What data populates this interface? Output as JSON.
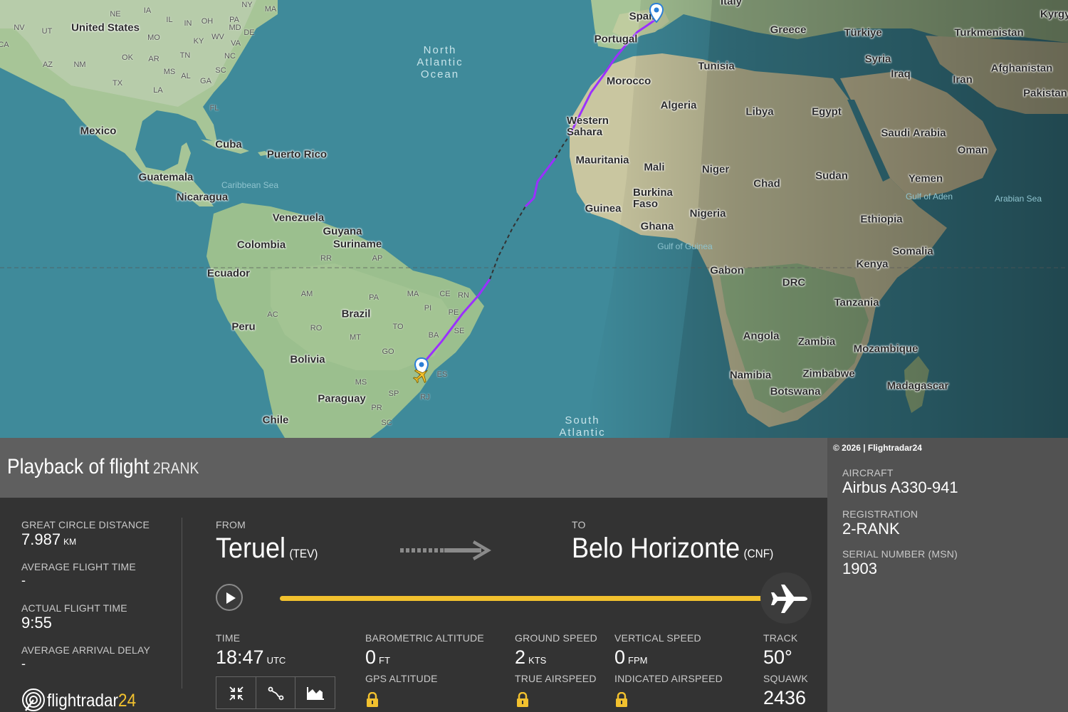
{
  "map": {
    "oceans": [
      {
        "lines": [
          "North",
          "Atlantic",
          "Ocean"
        ]
      },
      {
        "lines": [
          "South",
          "Atlantic"
        ]
      }
    ],
    "seas": [
      "Caribbean Sea",
      "Gulf of Guinea",
      "Gulf of Aden",
      "Arabian Sea"
    ],
    "countries": [
      "United States",
      "Mexico",
      "Cuba",
      "Puerto Rico",
      "Guatemala",
      "Nicaragua",
      "Venezuela",
      "Guyana",
      "Suriname",
      "Colombia",
      "Ecuador",
      "Brazil",
      "Peru",
      "Bolivia",
      "Paraguay",
      "Chile",
      "Portugal",
      "Spain",
      "Italy",
      "Greece",
      "Türkiye",
      "Turkmenistan",
      "Syria",
      "Iraq",
      "Iran",
      "Afghanistan",
      "Pakistan",
      "Tunisia",
      "Morocco",
      "Algeria",
      "Libya",
      "Egypt",
      "Saudi Arabia",
      "Oman",
      "Yemen",
      "Western Sahara",
      "Mauritania",
      "Mali",
      "Niger",
      "Chad",
      "Sudan",
      "Burkina Faso",
      "Guinea",
      "Ghana",
      "Nigeria",
      "Ethiopia",
      "Somalia",
      "Kenya",
      "Gabon",
      "DRC",
      "Tanzania",
      "Angola",
      "Zambia",
      "Mozambique",
      "Namibia",
      "Zimbabwe",
      "Botswana",
      "Madagascar",
      "Kyrgyz"
    ],
    "states": [
      "NV",
      "UT",
      "NE",
      "IA",
      "IL",
      "IN",
      "OH",
      "PA",
      "NY",
      "MA",
      "MD",
      "DE",
      "WV",
      "VA",
      "KY",
      "MO",
      "CA",
      "AZ",
      "NM",
      "OK",
      "AR",
      "TN",
      "NC",
      "SC",
      "GA",
      "AL",
      "MS",
      "LA",
      "TX",
      "FL",
      "AM",
      "PA",
      "MA",
      "CE",
      "RN",
      "PE",
      "PI",
      "AC",
      "RO",
      "MT",
      "TO",
      "BA",
      "SE",
      "GO",
      "MS",
      "ES",
      "SP",
      "RJ",
      "PR",
      "SC",
      "AP",
      "RR"
    ]
  },
  "copyright": "© 2026 | Flightradar24",
  "header": {
    "title": "Playback of flight",
    "flight_number": "2RANK"
  },
  "stats": {
    "great_circle_label": "GREAT CIRCLE DISTANCE",
    "great_circle_value": "7.987",
    "great_circle_unit": "KM",
    "avg_flight_time_label": "AVERAGE FLIGHT TIME",
    "avg_flight_time_value": "-",
    "actual_flight_time_label": "ACTUAL FLIGHT TIME",
    "actual_flight_time_value": "9:55",
    "avg_arrival_delay_label": "AVERAGE ARRIVAL DELAY",
    "avg_arrival_delay_value": "-"
  },
  "route": {
    "from_label": "FROM",
    "from_city": "Teruel",
    "from_code": "(TEV)",
    "to_label": "TO",
    "to_city": "Belo Horizonte",
    "to_code": "(CNF)"
  },
  "playback": {
    "progress": 1.0
  },
  "telemetry": {
    "time_label": "TIME",
    "time_value": "18:47",
    "time_unit": "UTC",
    "baro_label": "BAROMETRIC ALTITUDE",
    "baro_value": "0",
    "baro_unit": "FT",
    "gps_label": "GPS ALTITUDE",
    "ground_speed_label": "GROUND SPEED",
    "ground_speed_value": "2",
    "ground_speed_unit": "KTS",
    "true_airspeed_label": "TRUE AIRSPEED",
    "vertical_speed_label": "VERTICAL SPEED",
    "vertical_speed_value": "0",
    "vertical_speed_unit": "FPM",
    "indicated_airspeed_label": "INDICATED AIRSPEED",
    "track_label": "TRACK",
    "track_value": "50°",
    "squawk_label": "SQUAWK",
    "squawk_value": "2436"
  },
  "aircraft": {
    "aircraft_label": "AIRCRAFT",
    "aircraft_value": "Airbus A330-941",
    "registration_label": "REGISTRATION",
    "registration_value": "2-RANK",
    "serial_label": "SERIAL NUMBER (MSN)",
    "serial_value": "1903"
  },
  "logo": {
    "text_main": "flightradar",
    "text_num": "24"
  },
  "icons": [
    "origin-pin-icon",
    "destination-pin-icon",
    "aircraft-icon",
    "play-icon",
    "plane-handle-icon",
    "collapse-icon",
    "route-icon",
    "chart-icon",
    "lock-icon",
    "flightradar-logo-icon"
  ],
  "colors": {
    "track": "#f2c12e",
    "flight_path": "#9b30ff",
    "ocean": "#3f8a9a",
    "land": "#9bbf8e"
  }
}
